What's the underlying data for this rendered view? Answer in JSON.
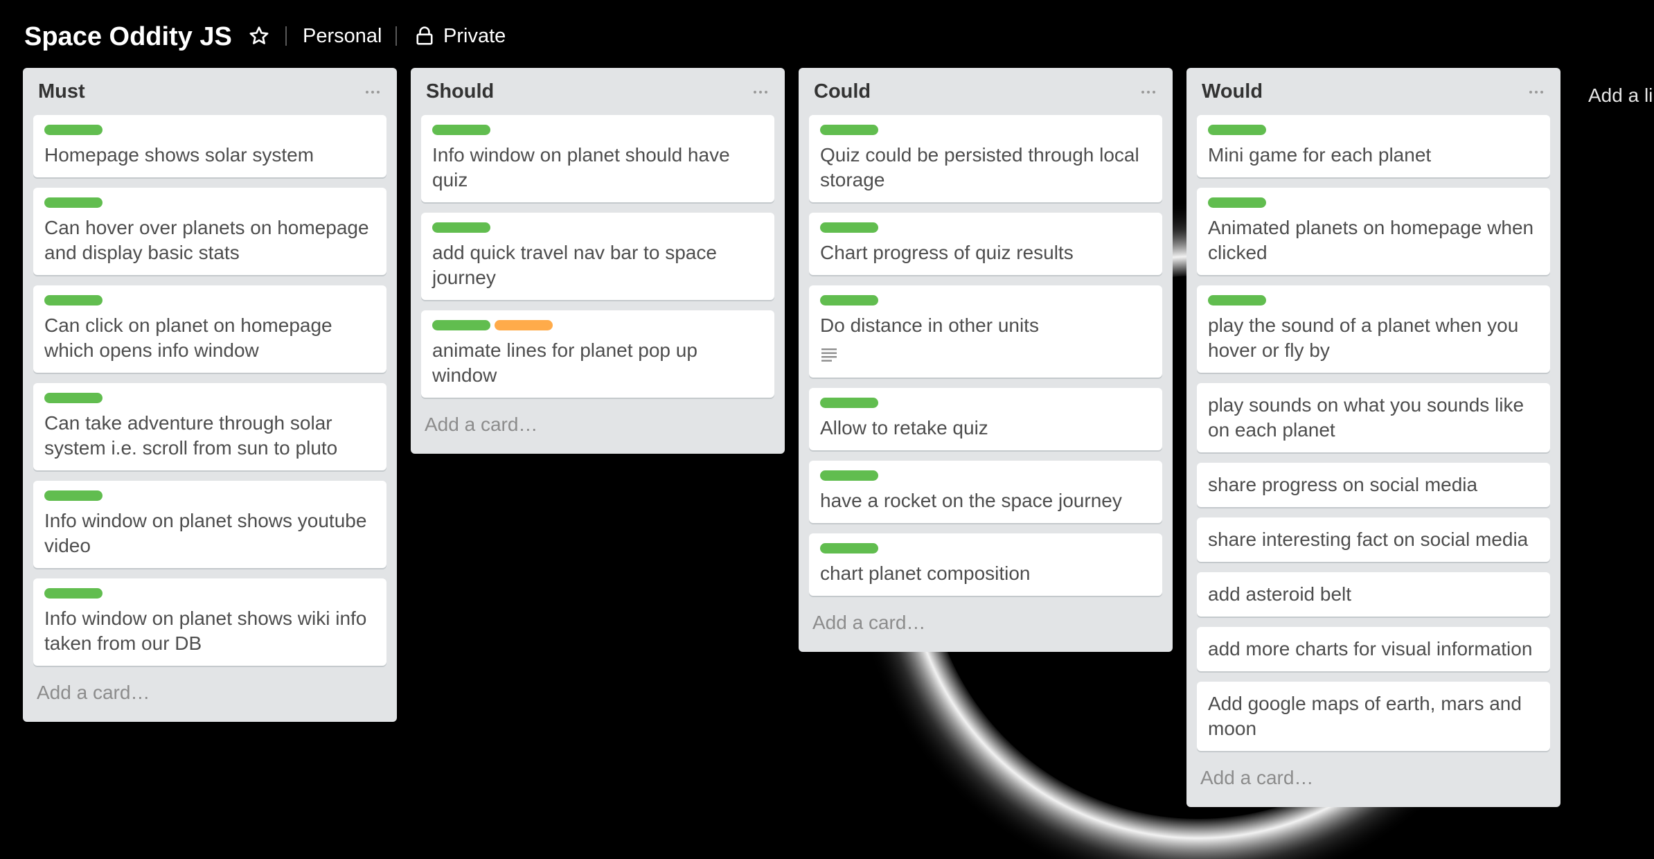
{
  "board": {
    "title": "Space Oddity JS",
    "team": "Personal",
    "visibility": "Private",
    "add_list_label": "Add a li"
  },
  "icons": {
    "star": "star-outline-icon",
    "lock": "lock-icon",
    "list_menu": "ellipsis-icon",
    "description": "description-lines-icon"
  },
  "colors": {
    "label_green": "#61bd4f",
    "label_orange": "#ffab4a",
    "list_bg": "#e2e4e6"
  },
  "lists": [
    {
      "title": "Must",
      "add_card": "Add a card…",
      "cards": [
        {
          "labels": [
            "green"
          ],
          "title": "Homepage shows solar system"
        },
        {
          "labels": [
            "green"
          ],
          "title": "Can hover over planets on homepage and display basic stats"
        },
        {
          "labels": [
            "green"
          ],
          "title": "Can click on planet on homepage which opens info window"
        },
        {
          "labels": [
            "green"
          ],
          "title": "Can take adventure through solar system i.e. scroll from sun to pluto"
        },
        {
          "labels": [
            "green"
          ],
          "title": "Info window on planet shows youtube video"
        },
        {
          "labels": [
            "green"
          ],
          "title": "Info window on planet shows wiki info taken from our DB"
        }
      ]
    },
    {
      "title": "Should",
      "add_card": "Add a card…",
      "cards": [
        {
          "labels": [
            "green"
          ],
          "title": "Info window on planet should have quiz"
        },
        {
          "labels": [
            "green"
          ],
          "title": "add quick travel nav bar to space journey"
        },
        {
          "labels": [
            "green",
            "orange"
          ],
          "title": "animate lines for planet pop up window"
        }
      ]
    },
    {
      "title": "Could",
      "add_card": "Add a card…",
      "cards": [
        {
          "labels": [
            "green"
          ],
          "title": "Quiz could be persisted through local storage"
        },
        {
          "labels": [
            "green"
          ],
          "title": "Chart progress of quiz results"
        },
        {
          "labels": [
            "green"
          ],
          "title": "Do distance in other units",
          "has_description": true
        },
        {
          "labels": [
            "green"
          ],
          "title": "Allow to retake quiz"
        },
        {
          "labels": [
            "green"
          ],
          "title": "have a rocket on the space journey"
        },
        {
          "labels": [
            "green"
          ],
          "title": "chart planet composition"
        }
      ]
    },
    {
      "title": "Would",
      "add_card": "Add a card…",
      "cards": [
        {
          "labels": [
            "green"
          ],
          "title": "Mini game for each planet"
        },
        {
          "labels": [
            "green"
          ],
          "title": "Animated planets on homepage when clicked"
        },
        {
          "labels": [
            "green"
          ],
          "title": "play the sound of a planet when you hover or fly by"
        },
        {
          "labels": [],
          "title": "play sounds on what you sounds like on each planet"
        },
        {
          "labels": [],
          "title": "share progress on social media"
        },
        {
          "labels": [],
          "title": "share interesting fact on social media"
        },
        {
          "labels": [],
          "title": "add asteroid belt"
        },
        {
          "labels": [],
          "title": "add more charts for visual information"
        },
        {
          "labels": [],
          "title": "Add google maps of earth, mars and moon"
        }
      ]
    }
  ]
}
